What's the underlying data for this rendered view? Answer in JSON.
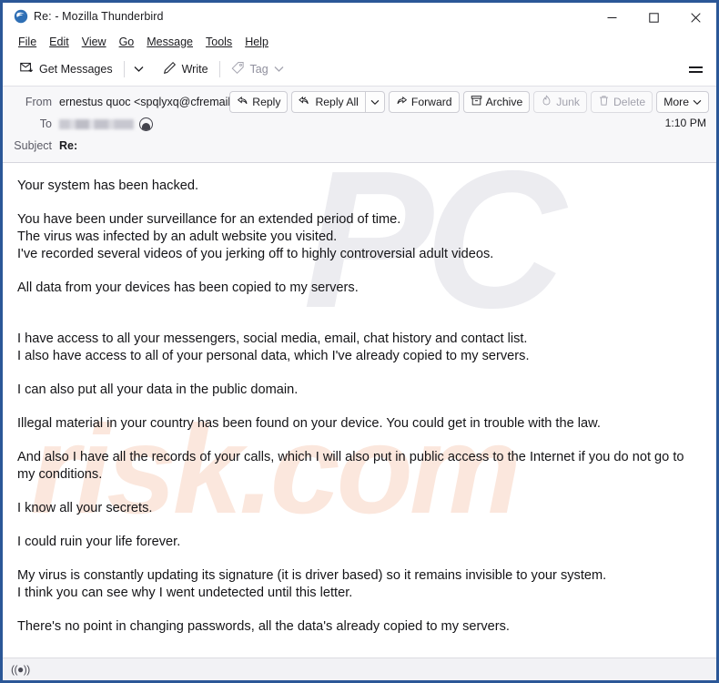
{
  "window": {
    "title": "Re: - Mozilla Thunderbird",
    "app_icon": "thunderbird-logo-icon",
    "controls": {
      "minimize": "─",
      "maximize": "□",
      "close": "✕"
    }
  },
  "menubar": {
    "items": [
      {
        "label": "File",
        "accel": "F"
      },
      {
        "label": "Edit",
        "accel": "E"
      },
      {
        "label": "View",
        "accel": "V"
      },
      {
        "label": "Go",
        "accel": "G"
      },
      {
        "label": "Message",
        "accel": "M"
      },
      {
        "label": "Tools",
        "accel": "T"
      },
      {
        "label": "Help",
        "accel": "H"
      }
    ]
  },
  "toolbar": {
    "get_messages_label": "Get Messages",
    "get_messages_caret": "⌄",
    "write_label": "Write",
    "tag_label": "Tag",
    "tag_caret": "⌄",
    "menu_button": "app-menu-hamburger"
  },
  "message_header": {
    "from_label": "From",
    "from_value": "ernestus quoc <spqlyxq@cfremails.com>",
    "to_label": "To",
    "to_value": "",
    "to_redacted": true,
    "subject_label": "Subject",
    "subject_value": "Re:",
    "timestamp": "1:10 PM",
    "actions": [
      {
        "label": "Reply",
        "icon": "reply-icon",
        "disabled": false,
        "caret": false
      },
      {
        "label": "Reply All",
        "icon": "reply-all-icon",
        "disabled": false,
        "caret": true
      },
      {
        "label": "Forward",
        "icon": "forward-icon",
        "disabled": false,
        "caret": false
      },
      {
        "label": "Archive",
        "icon": "archive-box-icon",
        "disabled": false,
        "caret": false
      },
      {
        "label": "Junk",
        "icon": "junk-flame-icon",
        "disabled": true,
        "caret": false
      },
      {
        "label": "Delete",
        "icon": "trash-icon",
        "disabled": true,
        "caret": false
      },
      {
        "label": "More",
        "icon": "",
        "disabled": false,
        "caret": true
      }
    ]
  },
  "body": {
    "watermark_primary": "PC",
    "watermark_secondary": "risk.com",
    "paragraphs": [
      {
        "lines": [
          "Your system has been hacked."
        ]
      },
      {
        "lines": [
          "You have been under surveillance for an extended period of time.",
          "The virus was infected by an adult website you visited.",
          "I've recorded several videos of you jerking off to highly controversial adult videos."
        ]
      },
      {
        "lines": [
          "All data from your devices has been copied to my servers."
        ]
      },
      {
        "lines": [
          "I have access to all your messengers, social media, email, chat history and contact list.",
          "I also have access to all of your personal data, which I've already copied to my servers."
        ]
      },
      {
        "lines": [
          "I can also put all your data in the public domain."
        ]
      },
      {
        "lines": [
          "Illegal material in your country has been found on your device. You could get in trouble with the law."
        ]
      },
      {
        "lines": [
          "And also I have all the records of your calls, which I will also put in public access to the Internet if you do not go to my conditions."
        ]
      },
      {
        "lines": [
          "I know all your secrets."
        ]
      },
      {
        "lines": [
          "I could ruin your life forever."
        ]
      },
      {
        "lines": [
          "My virus is constantly updating its signature (it is driver based) so it remains invisible to your system.",
          "I think you can see why I went undetected until this letter."
        ]
      },
      {
        "lines": [
          "There's no point in changing passwords, all the data's already copied to my servers."
        ]
      }
    ]
  },
  "statusbar": {
    "icon": "online-signal-icon",
    "icon_glyph": "((●))",
    "text": ""
  },
  "colors": {
    "window_frame": "#2b5797",
    "header_bg": "#f7f7f9",
    "body_bg": "#ffffff",
    "text": "#141417",
    "watermark_primary": "#ececf0",
    "watermark_secondary": "#fbe7dd"
  }
}
